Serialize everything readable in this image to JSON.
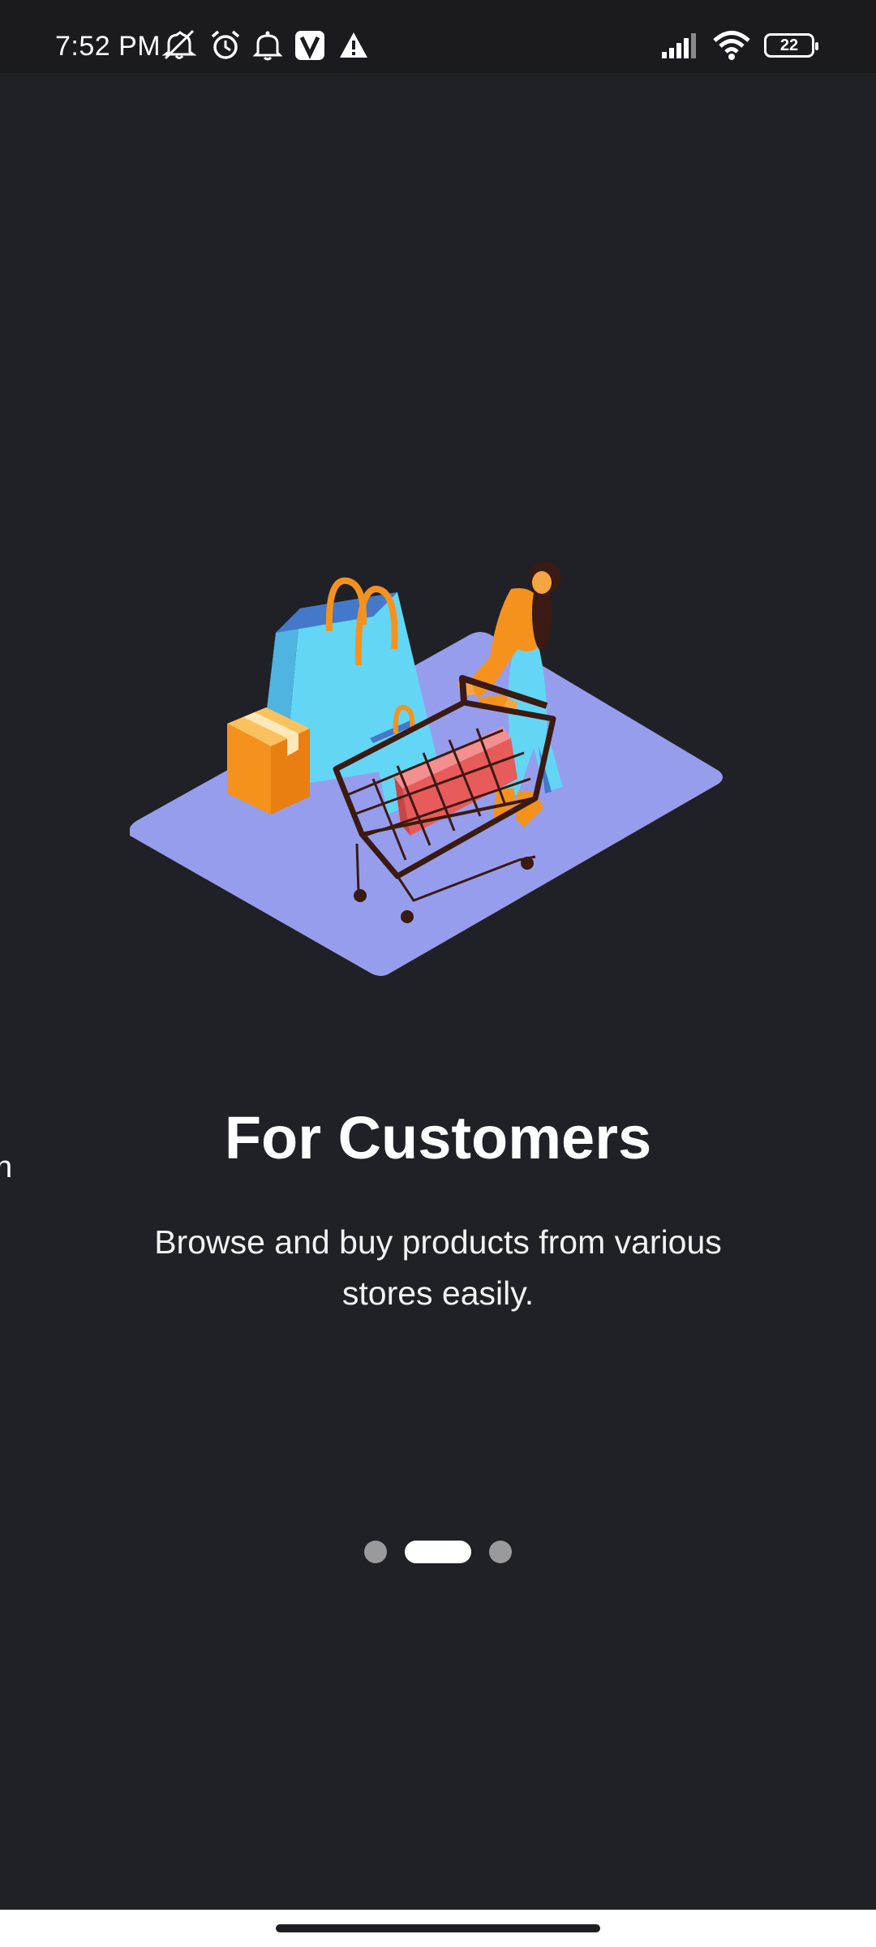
{
  "status_bar": {
    "time": "7:52 PM",
    "battery": "22",
    "icons_left": [
      "mute-icon",
      "alarm-icon",
      "notification-bell-icon",
      "v-app-icon",
      "warning-icon"
    ],
    "icons_right": [
      "signal-icon",
      "wifi-icon",
      "battery-icon"
    ]
  },
  "onboarding": {
    "peek_text": "n",
    "title": "For Customers",
    "description": "Browse and buy products from various stores easily.",
    "page_indicator": {
      "total": 3,
      "active_index": 1
    }
  },
  "colors": {
    "background": "#202127",
    "platform": "#979DED",
    "bag_blue": "#63D6F6",
    "bag_dark_blue": "#4478C9",
    "orange": "#F5921E",
    "cart_brown": "#3A1A12",
    "box_red": "#E85B5B"
  }
}
